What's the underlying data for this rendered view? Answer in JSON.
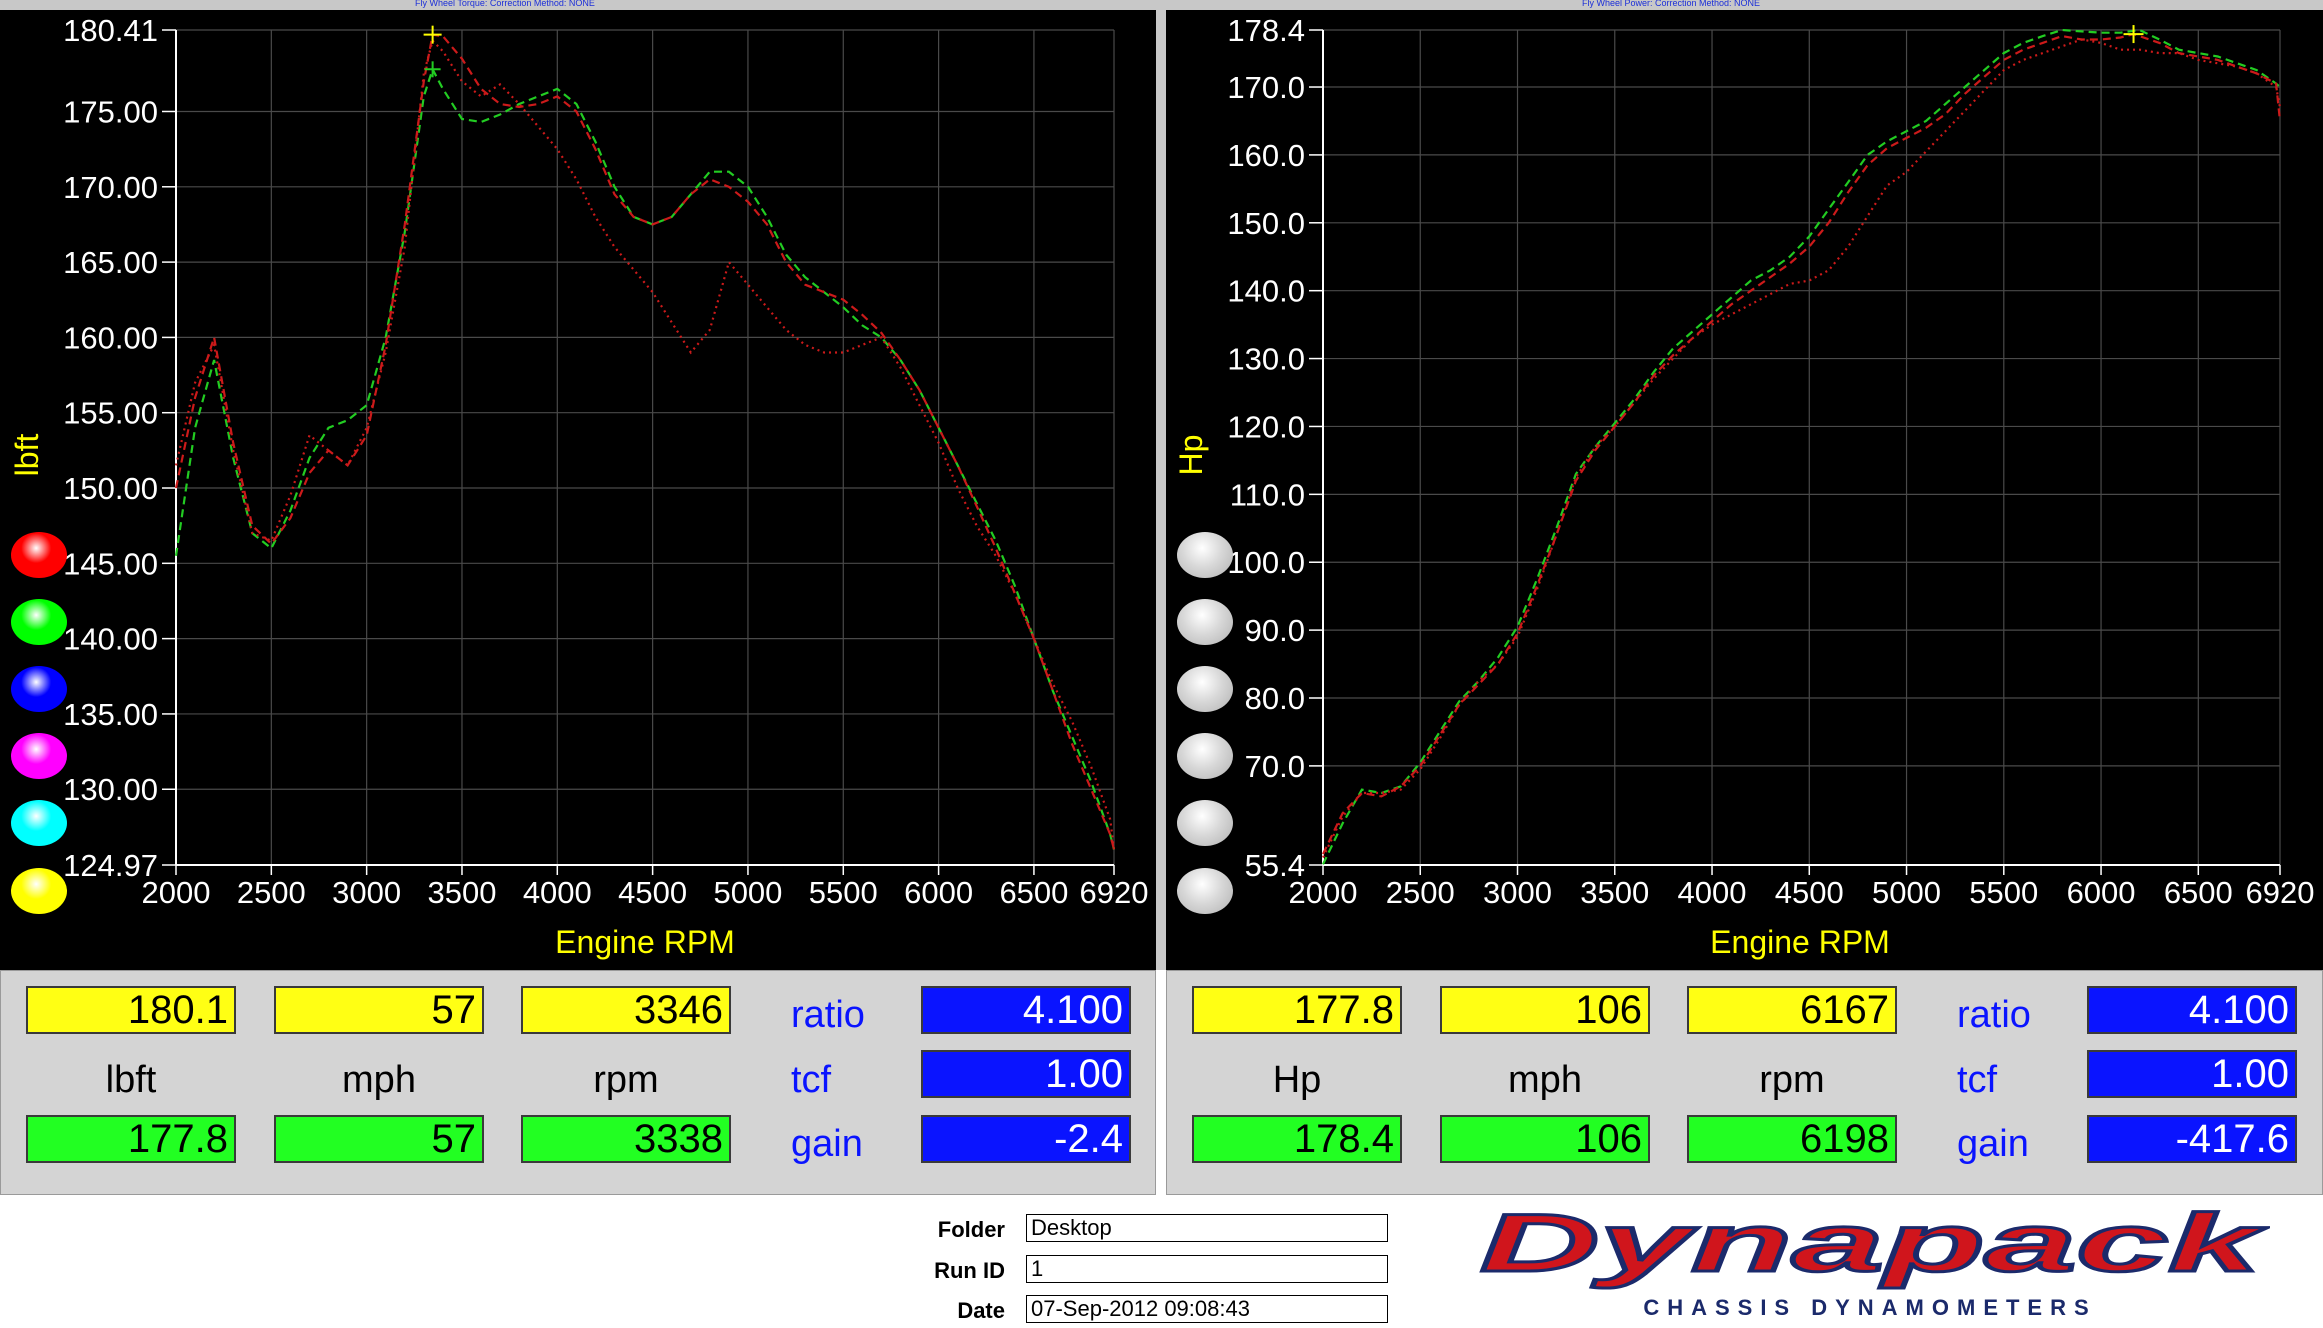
{
  "captions": {
    "torque_top": "Fly Wheel Torque:       Correction Method: NONE",
    "power_top": "Fly Wheel Power:       Correction Method: NONE"
  },
  "torque_chart": {
    "ylabel": "lbft",
    "xlabel": "Engine RPM",
    "ytick_labels": [
      "180.41",
      "175.00",
      "170.00",
      "165.00",
      "160.00",
      "155.00",
      "150.00",
      "145.00",
      "140.00",
      "135.00",
      "130.00",
      "124.97"
    ],
    "xtick_labels": [
      "2000",
      "2500",
      "3000",
      "3500",
      "4000",
      "4500",
      "5000",
      "5500",
      "6000",
      "6500",
      "6920"
    ]
  },
  "power_chart": {
    "ylabel": "Hp",
    "xlabel": "Engine RPM",
    "ytick_labels": [
      "178.4",
      "170.0",
      "160.0",
      "150.0",
      "140.0",
      "130.0",
      "120.0",
      "110.0",
      "100.0",
      "90.0",
      "80.0",
      "70.0",
      "55.4"
    ],
    "xtick_labels": [
      "2000",
      "2500",
      "3000",
      "3500",
      "4000",
      "4500",
      "5000",
      "5500",
      "6000",
      "6500",
      "6920"
    ]
  },
  "chart_data": [
    {
      "type": "line",
      "title": "",
      "xlabel": "Engine RPM",
      "ylabel": "lbft",
      "xlim": [
        2000,
        6920
      ],
      "ylim": [
        124.97,
        180.41
      ],
      "grid": true,
      "series": [
        {
          "color": "#22cc22",
          "style": "dashed",
          "x": [
            2000,
            2100,
            2200,
            2300,
            2400,
            2500,
            2600,
            2700,
            2800,
            2900,
            3000,
            3100,
            3200,
            3300,
            3346,
            3400,
            3500,
            3600,
            3700,
            3800,
            3900,
            4000,
            4100,
            4200,
            4300,
            4400,
            4500,
            4600,
            4700,
            4800,
            4900,
            5000,
            5100,
            5200,
            5300,
            5400,
            5500,
            5600,
            5700,
            5800,
            5900,
            6000,
            6100,
            6200,
            6300,
            6400,
            6500,
            6600,
            6700,
            6800,
            6900,
            6920
          ],
          "y": [
            145.5,
            154,
            158.5,
            152,
            147,
            146,
            148.5,
            152,
            154,
            154.5,
            155.5,
            160,
            167,
            176,
            177.8,
            176.5,
            174.5,
            174.3,
            174.8,
            175.5,
            176,
            176.5,
            175.5,
            173,
            170,
            168,
            167.5,
            168,
            169.5,
            171,
            171,
            170,
            168,
            165.5,
            164,
            163,
            162,
            160.8,
            160,
            158.5,
            156.5,
            154,
            151.5,
            149,
            146.5,
            143.5,
            140,
            136.5,
            133.5,
            130.5,
            127,
            126
          ]
        },
        {
          "color": "#cc1a1a",
          "style": "dashed",
          "x": [
            2000,
            2100,
            2200,
            2300,
            2400,
            2500,
            2600,
            2700,
            2800,
            2900,
            3000,
            3100,
            3200,
            3300,
            3346,
            3400,
            3500,
            3600,
            3700,
            3800,
            3900,
            4000,
            4100,
            4200,
            4300,
            4400,
            4500,
            4600,
            4700,
            4800,
            4900,
            5000,
            5100,
            5200,
            5300,
            5400,
            5500,
            5600,
            5700,
            5800,
            5900,
            6000,
            6100,
            6200,
            6300,
            6400,
            6500,
            6600,
            6700,
            6800,
            6900,
            6920
          ],
          "y": [
            150,
            156,
            160,
            153,
            147.5,
            146.3,
            148,
            151,
            152.5,
            151.5,
            153.5,
            159.5,
            167.5,
            177,
            180.1,
            180,
            178.5,
            176.5,
            175.5,
            175.3,
            175.5,
            176,
            175,
            172.5,
            169.5,
            168,
            167.5,
            168,
            169.5,
            170.5,
            170,
            169,
            167.5,
            165,
            163.5,
            163,
            162.5,
            161.5,
            160.3,
            158.5,
            156.5,
            154,
            151.5,
            148.8,
            146,
            143,
            140,
            136.5,
            133,
            130,
            127,
            126
          ]
        },
        {
          "color": "#cc1a1a",
          "style": "dotted",
          "x": [
            2000,
            2100,
            2200,
            2300,
            2400,
            2500,
            2600,
            2700,
            2800,
            2900,
            3000,
            3100,
            3200,
            3300,
            3346,
            3400,
            3500,
            3600,
            3700,
            3800,
            3900,
            4000,
            4100,
            4200,
            4300,
            4400,
            4500,
            4600,
            4700,
            4800,
            4900,
            5000,
            5100,
            5200,
            5300,
            5400,
            5500,
            5600,
            5700,
            5800,
            5900,
            6000,
            6100,
            6200,
            6300,
            6400,
            6500,
            6600,
            6700,
            6800,
            6900,
            6920
          ],
          "y": [
            151.5,
            157,
            159.5,
            152.5,
            147,
            146.5,
            149.5,
            153.5,
            152.5,
            151.5,
            154,
            159,
            166,
            177.5,
            179.7,
            179,
            177,
            176,
            176.8,
            175.5,
            174,
            172.5,
            170.5,
            168,
            166,
            164.5,
            163,
            161,
            159,
            160.5,
            165,
            163.5,
            162,
            160.5,
            159.5,
            159,
            159,
            159.5,
            160,
            158,
            155.5,
            153,
            150,
            147.5,
            145.5,
            143,
            140,
            137,
            134.5,
            131.5,
            128,
            126
          ]
        }
      ]
    },
    {
      "type": "line",
      "title": "",
      "xlabel": "Engine RPM",
      "ylabel": "Hp",
      "xlim": [
        2000,
        6920
      ],
      "ylim": [
        55.4,
        178.4
      ],
      "grid": true,
      "series": [
        {
          "color": "#22cc22",
          "style": "dashed",
          "x": [
            2000,
            2100,
            2200,
            2300,
            2400,
            2500,
            2600,
            2700,
            2800,
            2900,
            3000,
            3100,
            3200,
            3300,
            3400,
            3500,
            3600,
            3700,
            3800,
            3900,
            4000,
            4100,
            4200,
            4300,
            4400,
            4500,
            4600,
            4700,
            4800,
            4900,
            5000,
            5100,
            5200,
            5300,
            5400,
            5500,
            5600,
            5700,
            5800,
            5900,
            6000,
            6100,
            6198,
            6300,
            6400,
            6500,
            6600,
            6700,
            6800,
            6900,
            6920
          ],
          "y": [
            55.5,
            61.5,
            66.5,
            66,
            67,
            70.5,
            75,
            79.5,
            82.5,
            86,
            90.5,
            97.5,
            105,
            113,
            117,
            120.5,
            124,
            128,
            131.5,
            134,
            136.5,
            139,
            141.5,
            143,
            145,
            148,
            152,
            156,
            160,
            162,
            163.5,
            165,
            167.5,
            170,
            172.5,
            175,
            176.5,
            177.5,
            178.4,
            178.2,
            178,
            178,
            178.4,
            177,
            175.5,
            175,
            174.5,
            173.5,
            172.5,
            170.5,
            170
          ]
        },
        {
          "color": "#cc1a1a",
          "style": "dashed",
          "x": [
            2000,
            2100,
            2200,
            2300,
            2400,
            2500,
            2600,
            2700,
            2800,
            2900,
            3000,
            3100,
            3200,
            3300,
            3400,
            3500,
            3600,
            3700,
            3800,
            3900,
            4000,
            4100,
            4200,
            4300,
            4400,
            4500,
            4600,
            4700,
            4800,
            4900,
            5000,
            5100,
            5200,
            5300,
            5400,
            5500,
            5600,
            5700,
            5800,
            5900,
            6000,
            6100,
            6167,
            6300,
            6400,
            6500,
            6600,
            6700,
            6800,
            6900,
            6920
          ],
          "y": [
            57,
            63,
            66,
            65.5,
            67,
            70,
            74.5,
            79,
            82,
            85,
            89.5,
            96.5,
            104,
            112,
            116.5,
            120,
            123.5,
            127.5,
            130.5,
            133,
            135.5,
            138,
            140,
            142,
            144,
            146.5,
            150,
            154.5,
            158.5,
            161,
            162.5,
            164,
            166,
            169,
            171.5,
            174,
            175.5,
            176.5,
            177.5,
            177,
            177,
            177.3,
            177.8,
            176.5,
            175,
            174.5,
            174,
            173,
            172,
            170.5,
            165
          ]
        },
        {
          "color": "#cc1a1a",
          "style": "dotted",
          "x": [
            2000,
            2100,
            2200,
            2300,
            2400,
            2500,
            2600,
            2700,
            2800,
            2900,
            3000,
            3100,
            3200,
            3300,
            3400,
            3500,
            3600,
            3700,
            3800,
            3900,
            4000,
            4100,
            4200,
            4300,
            4400,
            4500,
            4600,
            4700,
            4800,
            4900,
            5000,
            5100,
            5200,
            5300,
            5400,
            5500,
            5600,
            5700,
            5800,
            5900,
            6000,
            6100,
            6200,
            6300,
            6400,
            6500,
            6600,
            6700,
            6800,
            6900,
            6920
          ],
          "y": [
            56.5,
            62.5,
            66,
            66,
            66.5,
            69.5,
            74,
            79,
            82.5,
            85,
            89,
            96,
            104,
            112.5,
            117,
            120,
            123.5,
            127,
            130,
            133,
            135,
            136.5,
            138,
            139.5,
            141,
            141.5,
            143,
            146.5,
            151,
            155.5,
            157.5,
            160.5,
            163.5,
            166.5,
            169.5,
            172.5,
            174,
            175,
            176,
            177,
            176.5,
            175.5,
            175.5,
            175,
            175,
            174,
            173.5,
            173,
            172,
            170,
            167
          ]
        }
      ]
    }
  ],
  "swatches": {
    "left": [
      "#ff0000",
      "#00ff00",
      "#0000ff",
      "#ff00ff",
      "#00ffff",
      "#ffff00"
    ],
    "right_color": "#d8d8d8"
  },
  "readout_left": {
    "top": [
      "180.1",
      "57",
      "3346"
    ],
    "units": [
      "lbft",
      "mph",
      "rpm"
    ],
    "bottom": [
      "177.8",
      "57",
      "3338"
    ],
    "ratio_label": "ratio",
    "ratio": "4.100",
    "tcf_label": "tcf",
    "tcf": "1.00",
    "gain_label": "gain",
    "gain": "-2.4"
  },
  "readout_right": {
    "top": [
      "177.8",
      "106",
      "6167"
    ],
    "units": [
      "Hp",
      "mph",
      "rpm"
    ],
    "bottom": [
      "178.4",
      "106",
      "6198"
    ],
    "ratio_label": "ratio",
    "ratio": "4.100",
    "tcf_label": "tcf",
    "tcf": "1.00",
    "gain_label": "gain",
    "gain": "-417.6"
  },
  "footer": {
    "folder_label": "Folder",
    "folder": "Desktop",
    "runid_label": "Run ID",
    "runid": "1",
    "date_label": "Date",
    "date": "07-Sep-2012  09:08:43"
  },
  "logo": {
    "name": "Dynapack",
    "tagline": "CHASSIS     DYNAMOMETERS",
    "brand_red": "#d0151c",
    "brand_navy": "#1b2a6b"
  }
}
